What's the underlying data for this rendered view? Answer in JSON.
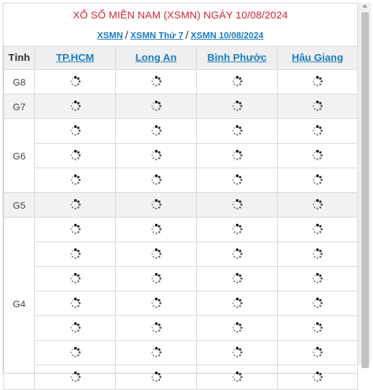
{
  "header": {
    "title": "XỔ SỐ MIỀN NAM (XSMN) NGÀY 10/08/2024",
    "breadcrumb": [
      "XSMN",
      "XSMN Thứ 7",
      "XSMN 10/08/2024"
    ],
    "separator": "/"
  },
  "table": {
    "first_col_header": "Tỉnh",
    "provinces": [
      "TP.HCM",
      "Long An",
      "Bình Phước",
      "Hậu Giang"
    ],
    "prizes": [
      {
        "label": "G8",
        "rows": 1,
        "shaded": false
      },
      {
        "label": "G7",
        "rows": 1,
        "shaded": true
      },
      {
        "label": "G6",
        "rows": 3,
        "shaded": false
      },
      {
        "label": "G5",
        "rows": 1,
        "shaded": true
      },
      {
        "label": "G4",
        "rows": 7,
        "shaded": false
      }
    ],
    "cell_state": "loading-spinner-icon"
  },
  "colors": {
    "title": "#d0263a",
    "link": "#1d7dc2",
    "header_bg": "#efefef",
    "shaded_row_bg": "#f2f2f2"
  }
}
